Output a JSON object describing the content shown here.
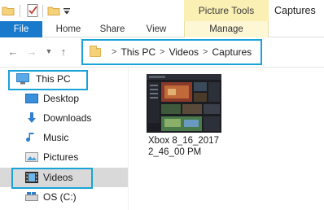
{
  "window": {
    "title": "Captures",
    "context_group": "Picture Tools"
  },
  "ribbon": {
    "tabs": [
      {
        "label": "File"
      },
      {
        "label": "Home"
      },
      {
        "label": "Share"
      },
      {
        "label": "View"
      },
      {
        "label": "Manage"
      }
    ]
  },
  "address_bar": {
    "path": [
      "This PC",
      "Videos",
      "Captures"
    ],
    "separator": ">"
  },
  "nav_pane": {
    "items": [
      {
        "label": "This PC",
        "icon": "computer-icon",
        "selected": false,
        "highlighted": true
      },
      {
        "label": "Desktop",
        "icon": "desktop-folder-icon"
      },
      {
        "label": "Downloads",
        "icon": "download-arrow-icon"
      },
      {
        "label": "Music",
        "icon": "music-note-icon"
      },
      {
        "label": "Pictures",
        "icon": "pictures-folder-icon"
      },
      {
        "label": "Videos",
        "icon": "film-icon",
        "selected": true,
        "highlighted": true
      },
      {
        "label": "OS (C:)",
        "icon": "drive-icon"
      }
    ]
  },
  "content": {
    "files": [
      {
        "name": "Xbox 8_16_2017 2_46_00 PM",
        "type": "video thumbnail"
      }
    ]
  },
  "colors": {
    "accent": "#1979ca",
    "highlight_box": "#1aa3d8",
    "context_tab": "#fbf0b4",
    "selected_row": "#d9d9d9"
  }
}
